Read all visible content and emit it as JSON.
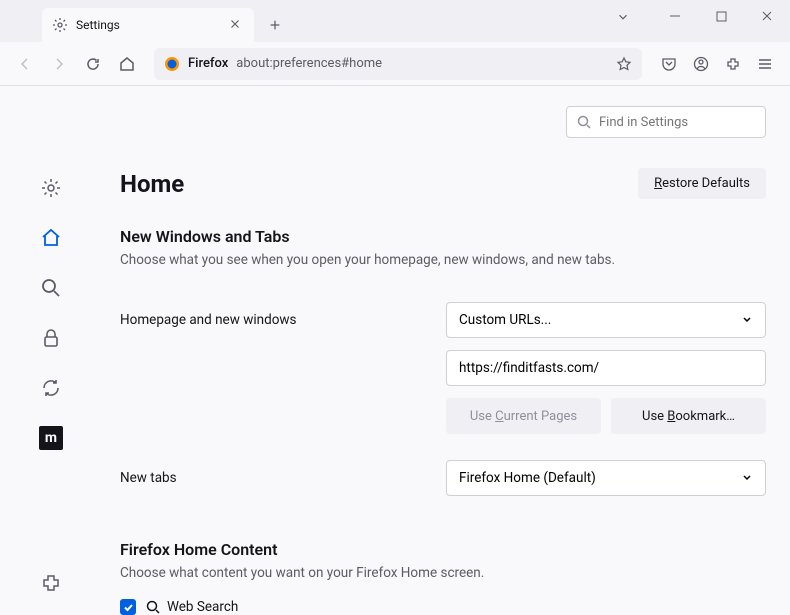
{
  "titlebar": {
    "tab_label": "Settings"
  },
  "urlbar": {
    "identity_label": "Firefox",
    "url_text": "about:preferences#home"
  },
  "search": {
    "placeholder": "Find in Settings"
  },
  "main": {
    "heading": "Home",
    "restore_label": "Restore Defaults",
    "section1": {
      "title": "New Windows and Tabs",
      "desc": "Choose what you see when you open your homepage, new windows, and new tabs.",
      "homepage_label": "Homepage and new windows",
      "homepage_select": "Custom URLs...",
      "homepage_url": "https://finditfasts.com/",
      "use_current": "Use Current Pages",
      "use_bookmark": "Use Bookmark…",
      "newtabs_label": "New tabs",
      "newtabs_select": "Firefox Home (Default)"
    },
    "section2": {
      "title": "Firefox Home Content",
      "desc": "Choose what content you want on your Firefox Home screen.",
      "websearch_label": "Web Search"
    }
  }
}
